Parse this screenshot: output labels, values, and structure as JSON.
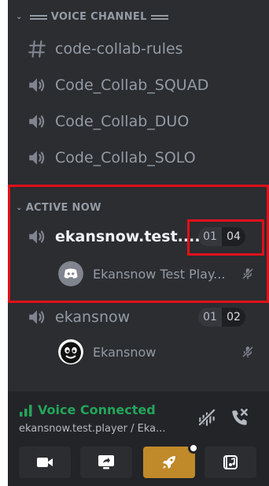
{
  "categories": {
    "voice_channel": "VOICE CHANNEL",
    "active_now": "ACTIVE NOW"
  },
  "channels": [
    {
      "name": "code-collab-rules",
      "icon": "hashtag-icon"
    },
    {
      "name": "Code_Collab_SQUAD",
      "icon": "speaker-icon"
    },
    {
      "name": "Code_Collab_DUO",
      "icon": "speaker-icon"
    },
    {
      "name": "Code_Collab_SOLO",
      "icon": "speaker-icon"
    }
  ],
  "active_channel": {
    "name": "ekansnow.test....",
    "count_current": "01",
    "count_limit": "04",
    "user": "Ekansnow Test Play..."
  },
  "other_channel": {
    "name": "ekansnow",
    "count_current": "01",
    "count_limit": "02",
    "user": "Ekansnow"
  },
  "footer": {
    "status": "Voice Connected",
    "subtitle": "ekansnow.test.player / Eka..."
  },
  "colors": {
    "highlight": "#e0101a",
    "connected": "#23a55a",
    "activity_button": "#c08a2a"
  }
}
